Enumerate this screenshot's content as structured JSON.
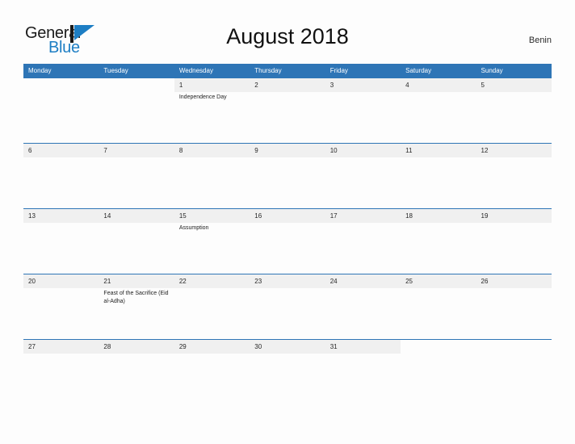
{
  "brand": {
    "name_part1": "General",
    "name_part2": "Blue",
    "flag_icon": "flag-triangle-icon",
    "blue": "#1d7ec4"
  },
  "header": {
    "title": "August 2018",
    "country": "Benin"
  },
  "theme": {
    "header_blue": "#2e75b6",
    "band_gray": "#f0f0f0",
    "page_bg": "#fdfdfd"
  },
  "calendar": {
    "weekdays": [
      "Monday",
      "Tuesday",
      "Wednesday",
      "Thursday",
      "Friday",
      "Saturday",
      "Sunday"
    ],
    "weeks": [
      [
        {
          "date": "",
          "events": []
        },
        {
          "date": "",
          "events": []
        },
        {
          "date": "1",
          "events": [
            "Independence Day"
          ]
        },
        {
          "date": "2",
          "events": []
        },
        {
          "date": "3",
          "events": []
        },
        {
          "date": "4",
          "events": []
        },
        {
          "date": "5",
          "events": []
        }
      ],
      [
        {
          "date": "6",
          "events": []
        },
        {
          "date": "7",
          "events": []
        },
        {
          "date": "8",
          "events": []
        },
        {
          "date": "9",
          "events": []
        },
        {
          "date": "10",
          "events": []
        },
        {
          "date": "11",
          "events": []
        },
        {
          "date": "12",
          "events": []
        }
      ],
      [
        {
          "date": "13",
          "events": []
        },
        {
          "date": "14",
          "events": []
        },
        {
          "date": "15",
          "events": [
            "Assumption"
          ]
        },
        {
          "date": "16",
          "events": []
        },
        {
          "date": "17",
          "events": []
        },
        {
          "date": "18",
          "events": []
        },
        {
          "date": "19",
          "events": []
        }
      ],
      [
        {
          "date": "20",
          "events": []
        },
        {
          "date": "21",
          "events": [
            "Feast of the Sacrifice (Eid al-Adha)"
          ]
        },
        {
          "date": "22",
          "events": []
        },
        {
          "date": "23",
          "events": []
        },
        {
          "date": "24",
          "events": []
        },
        {
          "date": "25",
          "events": []
        },
        {
          "date": "26",
          "events": []
        }
      ],
      [
        {
          "date": "27",
          "events": []
        },
        {
          "date": "28",
          "events": []
        },
        {
          "date": "29",
          "events": []
        },
        {
          "date": "30",
          "events": []
        },
        {
          "date": "31",
          "events": []
        },
        {
          "date": "",
          "events": []
        },
        {
          "date": "",
          "events": []
        }
      ]
    ]
  }
}
